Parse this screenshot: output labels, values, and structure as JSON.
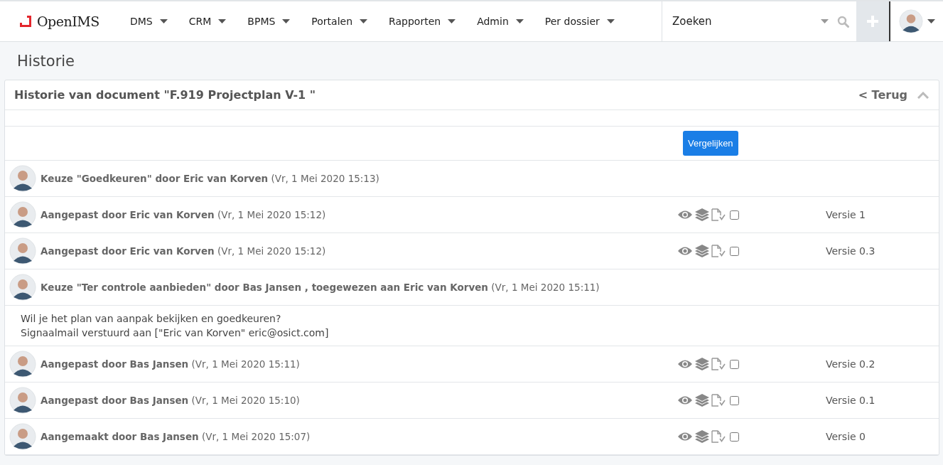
{
  "brand": {
    "name": "OpenIMS"
  },
  "nav": [
    {
      "label": "DMS"
    },
    {
      "label": "CRM"
    },
    {
      "label": "BPMS"
    },
    {
      "label": "Portalen"
    },
    {
      "label": "Rapporten"
    },
    {
      "label": "Admin"
    },
    {
      "label": "Per dossier"
    }
  ],
  "search": {
    "placeholder": "Zoeken"
  },
  "page_title": "Historie",
  "panel": {
    "title": "Historie van document \"F.919 Projectplan V-1 \"",
    "back": "< Terug",
    "compare_button": "Vergelijken"
  },
  "rows": [
    {
      "kind": "event",
      "title": "Keuze \"Goedkeuren\" door Eric van Korven",
      "date": "(Vr, 1 Mei 2020 15:13)"
    },
    {
      "kind": "version",
      "title": "Aangepast door Eric van Korven",
      "date": "(Vr, 1 Mei 2020 15:12)",
      "checked": false,
      "version": "Versie 1"
    },
    {
      "kind": "version",
      "title": "Aangepast door Eric van Korven",
      "date": "(Vr, 1 Mei 2020 15:12)",
      "checked": false,
      "version": "Versie 0.3"
    },
    {
      "kind": "event",
      "title": "Keuze \"Ter controle aanbieden\" door Bas Jansen , toegewezen aan Eric van Korven",
      "date": "(Vr, 1 Mei 2020 15:11)"
    },
    {
      "kind": "note",
      "lines": [
        "Wil je het plan van aanpak bekijken en goedkeuren?",
        "Signaalmail verstuurd aan [\"Eric van Korven\" eric@osict.com]"
      ]
    },
    {
      "kind": "version",
      "title": "Aangepast door Bas Jansen",
      "date": "(Vr, 1 Mei 2020 15:11)",
      "checked": false,
      "version": "Versie 0.2"
    },
    {
      "kind": "version",
      "title": "Aangepast door Bas Jansen",
      "date": "(Vr, 1 Mei 2020 15:10)",
      "checked": false,
      "version": "Versie 0.1"
    },
    {
      "kind": "version",
      "title": "Aangemaakt door Bas Jansen",
      "date": "(Vr, 1 Mei 2020 15:07)",
      "checked": false,
      "version": "Versie 0"
    }
  ]
}
